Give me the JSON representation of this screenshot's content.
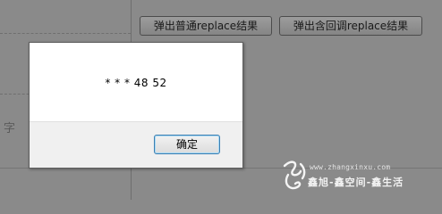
{
  "background": {
    "buttons": [
      {
        "label": "弹出普通replace结果"
      },
      {
        "label": "弹出含回调replace结果"
      }
    ],
    "partial_char": "字"
  },
  "dialog": {
    "message": "* * * 48 52",
    "ok_label": "确定"
  },
  "watermark": {
    "url": "www.zhangxinxu.com",
    "slogan": "鑫旭-鑫空间-鑫生活"
  },
  "colors": {
    "overlay_bg": "#8a8a8a",
    "dialog_bg": "#ffffff",
    "footer_bg": "#f0f0f0",
    "ok_border": "#3c7fb1"
  }
}
